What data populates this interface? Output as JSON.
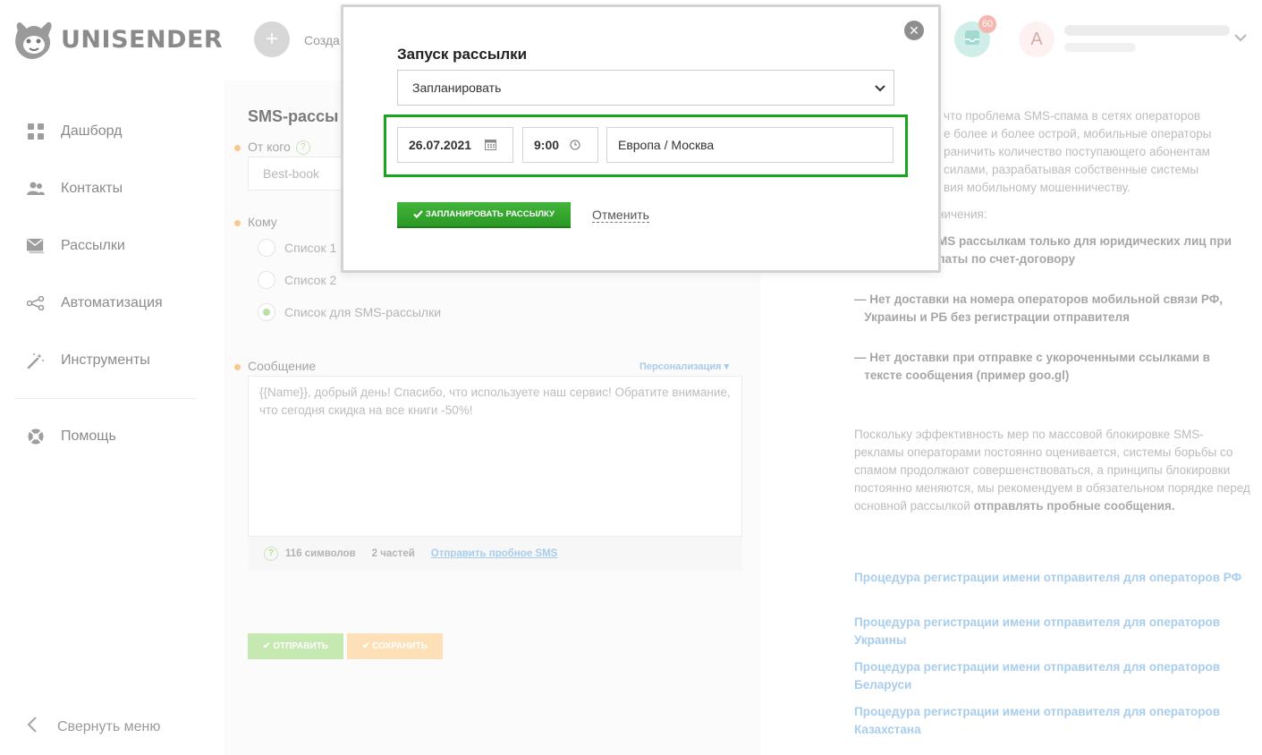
{
  "brand": {
    "name": "UNISENDER"
  },
  "sidebar": {
    "items": [
      {
        "label": "Дашборд",
        "icon": "dashboard-icon"
      },
      {
        "label": "Контакты",
        "icon": "contacts-icon"
      },
      {
        "label": "Рассылки",
        "icon": "mail-icon"
      },
      {
        "label": "Автоматизация",
        "icon": "automation-icon"
      },
      {
        "label": "Инструменты",
        "icon": "magic-wand-icon"
      }
    ],
    "help": "Помощь",
    "collapse": "Свернуть меню"
  },
  "topbar": {
    "create_label": "Созда",
    "badge_count": "60",
    "avatar_letter": "A"
  },
  "form": {
    "title": "SMS-рассы",
    "from_label": "От кого",
    "from_value": "Best-book",
    "to_label": "Кому",
    "lists": [
      "Список 1",
      "Список 2",
      "Список для SMS-рассылки"
    ],
    "message_label": "Сообщение",
    "personalization": "Персонализация ▾",
    "message_text": "{{Name}}, добрый день! Спасибо, что используете наш сервис! Обратите внимание, что сегодня скидка на все книги -50%!",
    "chars": "116 символов",
    "parts": "2 частей",
    "test_link": "Отправить пробное SMS",
    "send_button": "ОТПРАВИТЬ",
    "save_button": "СОХРАНИТЬ"
  },
  "info": {
    "intro": "что проблема SMS-спама в сетях операторов\nе более и более острой, мобильные операторы\nраничить количество поступающего абонентам\n силами, разрабатывая собственные системы\nвия мобильному мошенничеству.",
    "restrictions": "ничения:",
    "r1": "MS рассылкам только для юридических лиц при\nлаты по счет-договору",
    "r2": "— Нет доставки на номера операторов мобильной связи РФ,\n   Украины и РБ без регистрации отправителя",
    "r3": "— Нет доставки при отправке с укороченными ссылками в\n   тексте сообщения (пример goo.gl)",
    "para": "Поскольку эффективность мер по массовой блокировке SMS-рекламы операторами постоянно оценивается, системы борьбы со спамом продолжают совершенствоваться, а принципы блокировки постоянно меняются, мы рекомендуем в обязательном порядке перед основной рассылкой",
    "para_bold": "отправлять пробные сообщения.",
    "links": [
      "Процедура регистрации имени отправителя для операторов РФ",
      "Процедура регистрации имени отправителя для операторов Украины",
      "Процедура регистрации имени отправителя для операторов Беларуси",
      "Процедура регистрации имени отправителя для операторов Казахстана"
    ]
  },
  "modal": {
    "title": "Запуск рассылки",
    "mode_value": "Запланировать",
    "date_value": "26.07.2021",
    "time_value": "9:00",
    "timezone_value": "Европа / Москва",
    "schedule_button": "ЗАПЛАНИРОВАТЬ РАССЫЛКУ",
    "cancel": "Отменить"
  },
  "colors": {
    "highlight": "#1aa51e",
    "primary_button": "#2fa52a",
    "link": "#a9cdec"
  }
}
